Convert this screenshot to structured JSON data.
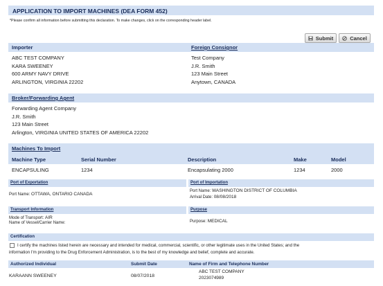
{
  "title": "APPLICATION TO IMPORT MACHINES (DEA FORM 452)",
  "note": "*Please confirm all information before submitting this declaration. To make changes, click on the corresponding header label.",
  "buttons": {
    "submit": "Submit",
    "cancel": "Cancel"
  },
  "importer": {
    "header": "Importer",
    "lines": [
      "ABC TEST COMPANY",
      "KARA SWEENEY",
      "600 ARMY NAVY DRIVE",
      "ARLINGTON,  VIRGINIA  22202"
    ]
  },
  "consignor": {
    "header": "Foreign Consignor",
    "lines": [
      "Test Company",
      "J.R. Smith",
      "123 Main Street",
      "Anytown,  CANADA"
    ]
  },
  "broker": {
    "header": "Broker/Forwarding Agent",
    "lines": [
      "Forwarding Agent Company",
      "J.R. Smith",
      "123 Main Street",
      "Arlington,  VIRGINIA  UNITED STATES OF AMERICA  22202"
    ]
  },
  "machines": {
    "header": "Machines To  Import",
    "columns": [
      "Machine Type",
      "Serial Number",
      "Description",
      "Make",
      "Model"
    ],
    "rows": [
      [
        "ENCAPSULING",
        "1234",
        "Encapsulating 2000",
        "1234",
        "2000"
      ]
    ]
  },
  "export": {
    "header": "Port of Exportation",
    "label": "Port Name:",
    "value": "OTTAWA, ONTARIO CANADA"
  },
  "import": {
    "header": "Port of Importation",
    "name_label": "Port Name:",
    "name_value": "WASHINGTON DISTRICT OF COLUMBIA",
    "date_label": "Arrival Date:",
    "date_value": "08/08/2018"
  },
  "transport": {
    "header": "Transport Information",
    "mode_label": "Mode of Transport:",
    "mode_value": "AIR",
    "vessel_label": "Name of Vessel/Carrier Name:",
    "vessel_value": ""
  },
  "purpose": {
    "header": "Purpose",
    "label": "Purpose:",
    "value": "MEDICAL"
  },
  "certification": {
    "header": "Certification",
    "line1": "I certify the machines listed herein are necessary and intended for medical, commercial, scientific, or other legitimate uses in the United States; and the",
    "line2": "information I'm providing to the Drug Enforcement Administration, is to the best of my knowledge and belief, complete and accurate."
  },
  "signature": {
    "columns": [
      "Authorized Individual",
      "Submit Date",
      "Name of Firm and Telephone Number"
    ],
    "individual": "KARAANN  SWEENEY",
    "date": "08/07/2018",
    "firm": "ABC TEST COMPANY",
    "phone": "2023074989"
  },
  "colors": {
    "header_bg": "#d3e0f3",
    "header_text": "#1a2d5a"
  }
}
